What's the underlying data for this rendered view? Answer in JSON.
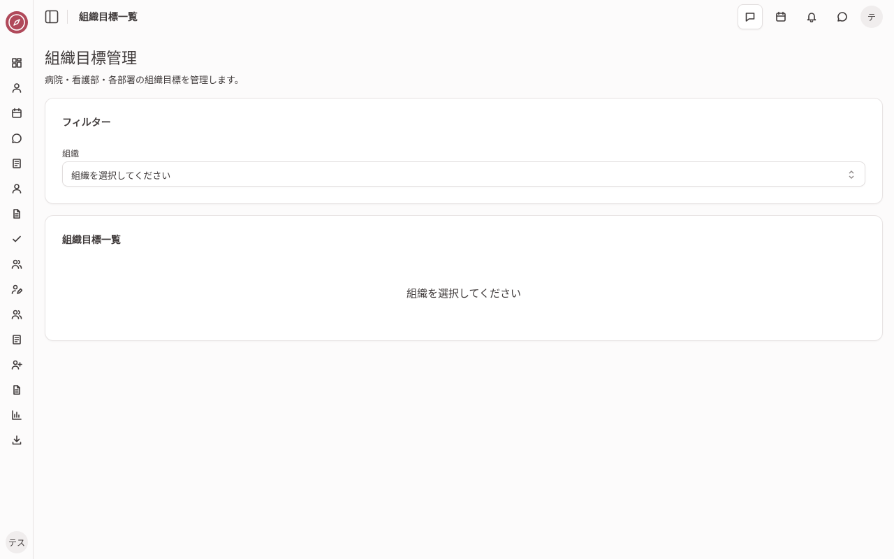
{
  "header": {
    "title": "組織目標一覧",
    "avatar_initial": "テ"
  },
  "sidebar": {
    "user_initials": "テス",
    "items": [
      {
        "icon": "dashboard-icon"
      },
      {
        "icon": "user-icon"
      },
      {
        "icon": "calendar-icon"
      },
      {
        "icon": "chat-icon"
      },
      {
        "icon": "document-icon"
      },
      {
        "icon": "user-icon"
      },
      {
        "icon": "file-text-icon"
      },
      {
        "icon": "check-icon"
      },
      {
        "icon": "users-icon"
      },
      {
        "icon": "user-edit-icon"
      },
      {
        "icon": "users-icon"
      },
      {
        "icon": "document-icon"
      },
      {
        "icon": "user-plus-icon"
      },
      {
        "icon": "file-text-icon"
      },
      {
        "icon": "bar-chart-icon"
      },
      {
        "icon": "download-icon"
      }
    ]
  },
  "page": {
    "title": "組織目標管理",
    "description": "病院・看護部・各部署の組織目標を管理します。"
  },
  "filter": {
    "title": "フィルター",
    "org_label": "組織",
    "org_placeholder": "組織を選択してください"
  },
  "goals": {
    "title": "組織目標一覧",
    "empty_message": "組織を選択してください"
  },
  "colors": {
    "brand": "#b0495a",
    "text": "#3f3a3a",
    "border": "#e7e3e3",
    "background": "#fcfbfb"
  }
}
